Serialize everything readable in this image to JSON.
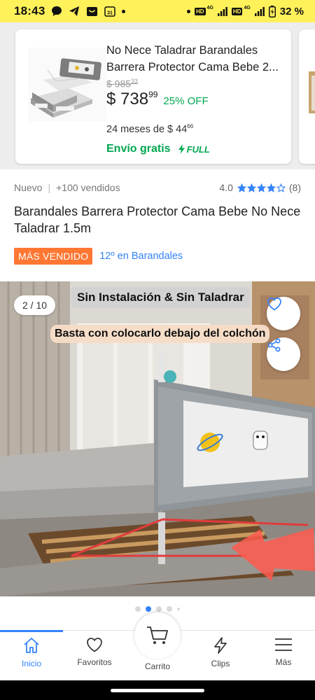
{
  "status_bar": {
    "time": "18:43",
    "network_tag": "HD",
    "network_type": "4G",
    "battery": "32 %"
  },
  "card": {
    "title": "No Nece Taladrar Barandales Barrera Protector Cama Bebe 2...",
    "old_price": "$ 985",
    "old_price_cents": "33",
    "price": "$ 738",
    "price_cents": "99",
    "discount": "25% OFF",
    "installments": "24 meses de $ 44",
    "installments_cents": "66",
    "shipping": "Envío gratis",
    "full_label": "FULL"
  },
  "product": {
    "condition": "Nuevo",
    "sold": "+100 vendidos",
    "rating": "4.0",
    "rating_value": 4,
    "rating_max": 5,
    "reviews": "(8)",
    "title": "Barandales Barrera Protector Cama Bebe No Nece Taladrar 1.5m",
    "badge": "MÁS VENDIDO",
    "rank": "12º en Barandales"
  },
  "gallery": {
    "counter": "2 / 10",
    "caption_top": "Sin Instalación & Sin Taladrar",
    "caption_bottom": "Basta con colocarlo debajo del colchón",
    "current_index": 2,
    "total": 10
  },
  "nav": {
    "items": [
      {
        "label": "Inicio",
        "icon": "home-icon",
        "active": true
      },
      {
        "label": "Favoritos",
        "icon": "heart-icon",
        "active": false
      },
      {
        "label": "Carrito",
        "icon": "cart-icon",
        "active": false
      },
      {
        "label": "Clips",
        "icon": "clips-icon",
        "active": false
      },
      {
        "label": "Más",
        "icon": "menu-icon",
        "active": false
      }
    ]
  },
  "colors": {
    "status_yellow": "#fff159",
    "green": "#00a650",
    "blue": "#3483fa",
    "orange": "#ff7733"
  }
}
